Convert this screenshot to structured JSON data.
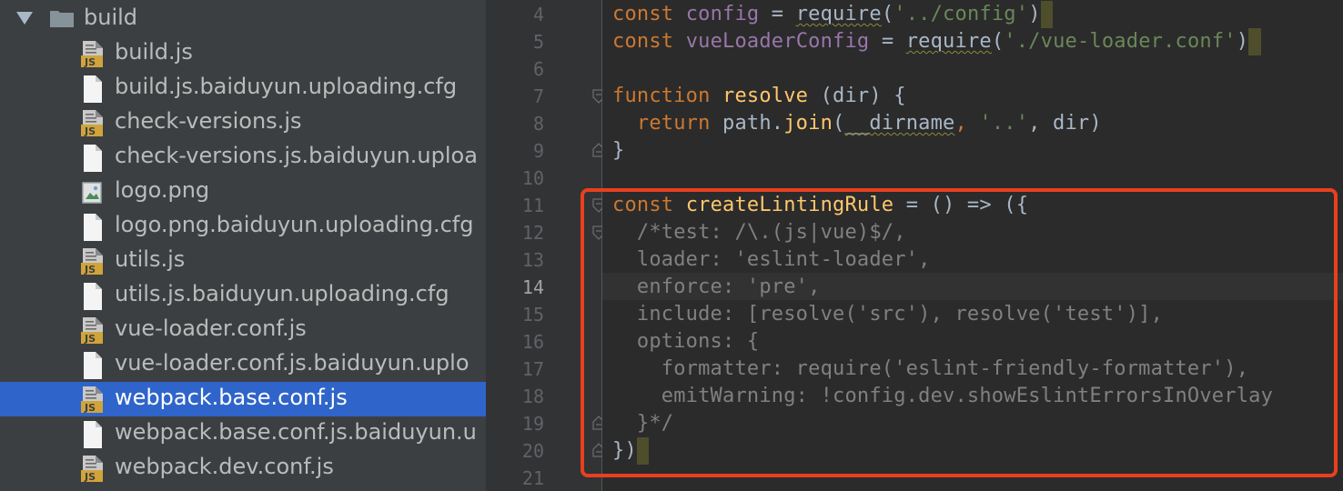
{
  "tree": {
    "folder": {
      "label": "build",
      "icon": "folder-icon"
    },
    "files": [
      {
        "label": "build.js",
        "icon": "js-file-icon",
        "selected": false
      },
      {
        "label": "build.js.baiduyun.uploading.cfg",
        "icon": "text-file-icon",
        "selected": false
      },
      {
        "label": "check-versions.js",
        "icon": "js-file-icon",
        "selected": false
      },
      {
        "label": "check-versions.js.baiduyun.uploa",
        "icon": "text-file-icon",
        "selected": false
      },
      {
        "label": "logo.png",
        "icon": "image-file-icon",
        "selected": false
      },
      {
        "label": "logo.png.baiduyun.uploading.cfg",
        "icon": "text-file-icon",
        "selected": false
      },
      {
        "label": "utils.js",
        "icon": "js-file-icon",
        "selected": false
      },
      {
        "label": "utils.js.baiduyun.uploading.cfg",
        "icon": "text-file-icon",
        "selected": false
      },
      {
        "label": "vue-loader.conf.js",
        "icon": "js-file-icon",
        "selected": false
      },
      {
        "label": "vue-loader.conf.js.baiduyun.uplo",
        "icon": "text-file-icon",
        "selected": false
      },
      {
        "label": "webpack.base.conf.js",
        "icon": "js-file-icon",
        "selected": true
      },
      {
        "label": "webpack.base.conf.js.baiduyun.u",
        "icon": "text-file-icon",
        "selected": false
      },
      {
        "label": "webpack.dev.conf.js",
        "icon": "js-file-icon",
        "selected": false
      }
    ],
    "js_badge": "JS"
  },
  "editor": {
    "current_line": "14",
    "line_numbers": [
      "4",
      "5",
      "6",
      "7",
      "8",
      "9",
      "10",
      "11",
      "12",
      "13",
      "14",
      "15",
      "16",
      "17",
      "18",
      "19",
      "20",
      "21"
    ],
    "code": {
      "l4": {
        "kw": "const",
        "name": "config",
        "eq": " = ",
        "req": "require",
        "open": "(",
        "str": "'../config'",
        "close": ")"
      },
      "l5": {
        "kw": "const",
        "name": "vueLoaderConfig",
        "eq": " = ",
        "req": "require",
        "open": "(",
        "str": "'./vue-loader.conf'",
        "close": ")"
      },
      "l7": {
        "kw": "function",
        "name": "resolve",
        "params": " (dir) {"
      },
      "l8": {
        "kw": "return",
        "call": " path.",
        "fn": "join",
        "open": "(",
        "dirname": "__dirname",
        "comma1": ", ",
        "str": "'..'",
        "rest": ", dir)"
      },
      "l9": {
        "text": "}"
      },
      "l11": {
        "kw": "const",
        "name": "createLintingRule",
        "rest": " = () => ({"
      },
      "l12": {
        "text": "/*test: /\\.(js|vue)$/,"
      },
      "l13": {
        "text": "loader: 'eslint-loader',"
      },
      "l14": {
        "text": "enforce: 'pre',"
      },
      "l15": {
        "text": "include: [resolve('src'), resolve('test')],"
      },
      "l16": {
        "text": "options: {"
      },
      "l17": {
        "text": "formatter: require('eslint-friendly-formatter'),"
      },
      "l18": {
        "text": "emitWarning: !config.dev.showEslintErrorsInOverlay"
      },
      "l19": {
        "text": "}*/"
      },
      "l20": {
        "text": "})"
      }
    }
  },
  "colors": {
    "tree_bg": "#3c3f41",
    "selection": "#2f65ca",
    "editor_bg": "#2b2b2b",
    "keyword": "#cc7832",
    "string": "#6a8759",
    "comment": "#808080",
    "function_name": "#ffc66d",
    "highlight_box": "#e8401e"
  }
}
